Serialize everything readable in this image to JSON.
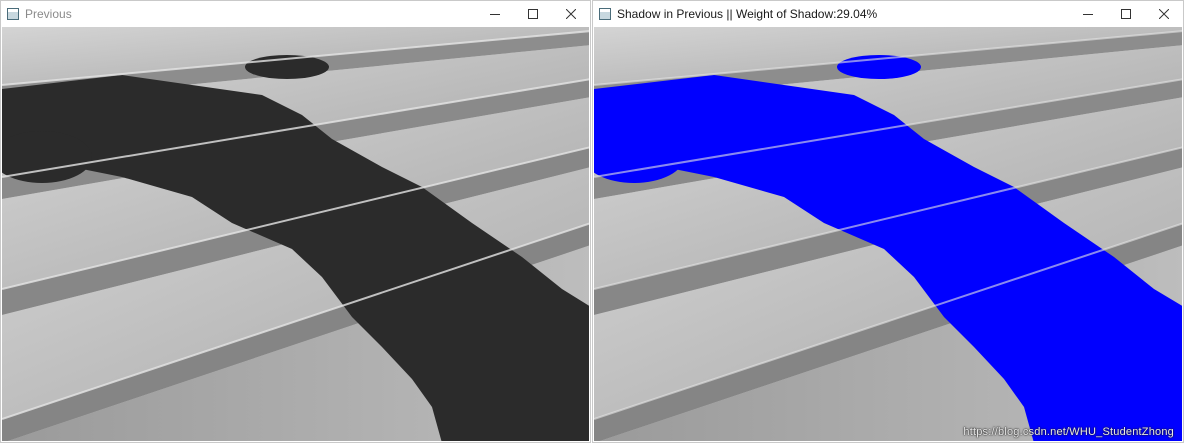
{
  "windows": [
    {
      "title": "Previous"
    },
    {
      "title": "Shadow in Previous  ||  Weight of Shadow:29.04%"
    }
  ],
  "icons": {
    "app": "window-app-icon",
    "minimize": "minimize-icon",
    "maximize": "maximize-icon",
    "close": "close-icon"
  },
  "colors": {
    "shadow_mask": "#0000ff",
    "stone_light": "#c2c2c2",
    "stone_dark": "#2e2e2e"
  },
  "shadow_weight_percent": 29.04,
  "watermark": "https://blog.csdn.net/WHU_StudentZhong"
}
